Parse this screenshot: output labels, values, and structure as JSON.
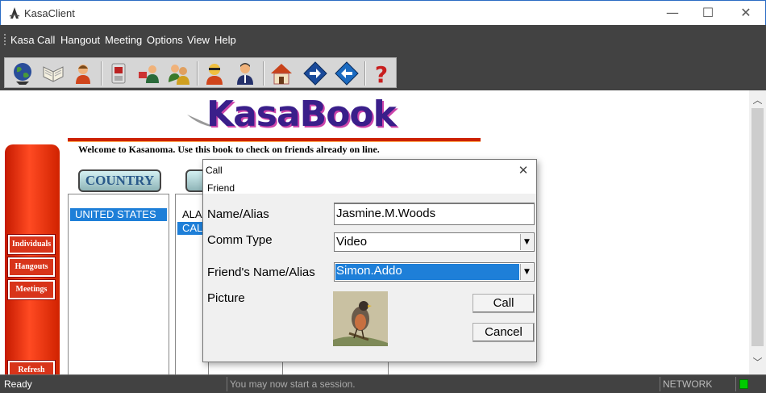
{
  "window": {
    "title": "KasaClient",
    "icon": "kasa-app-icon",
    "minimize": "—",
    "maximize": "☐",
    "close": "✕"
  },
  "menu": [
    "Kasa",
    "Call",
    "Hangout",
    "Meeting",
    "Options",
    "View",
    "Help"
  ],
  "toolbar": [
    "globe-icon",
    "book-icon",
    "individual-icon",
    "phone-icon",
    "contact-icon",
    "group-icon",
    "sunglasses-user-icon",
    "business-user-icon",
    "home-icon",
    "forward-icon",
    "back-icon",
    "help-icon"
  ],
  "page": {
    "logo": "KasaBook",
    "welcome": "Welcome to Kasanoma. Use this book to check on friends already on line.",
    "country_button": "COUNTRY",
    "countries": [
      "UNITED STATES"
    ],
    "states": [
      "ALA",
      "CAL"
    ],
    "side_buttons": [
      "Individuals",
      "Hangouts",
      "Meetings",
      "Refresh"
    ]
  },
  "dialog": {
    "title": "Call",
    "menu": "Friend",
    "name_label": "Name/Alias",
    "name_value": "Jasmine.M.Woods",
    "comm_label": "Comm Type",
    "comm_value": "Video",
    "friend_label": "Friend's Name/Alias",
    "friend_value": "Simon.Addo",
    "picture_label": "Picture",
    "call_button": "Call",
    "cancel_button": "Cancel"
  },
  "status": {
    "left": "Ready",
    "middle": "You may now start a session.",
    "right": "NETWORK",
    "led_color": "#00cc00"
  },
  "colors": {
    "accent": "#1e7fd8",
    "dark_bar": "#424242",
    "side_panel": "#e0300a"
  }
}
